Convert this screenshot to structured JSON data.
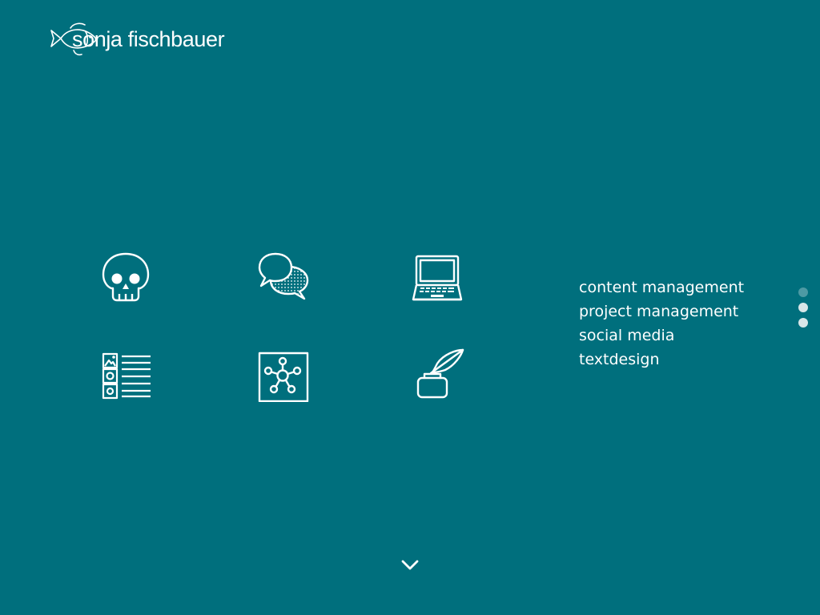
{
  "logo": {
    "text": "sonja fischbauer"
  },
  "icons": [
    {
      "name": "skull-icon"
    },
    {
      "name": "speech-bubbles-icon"
    },
    {
      "name": "laptop-icon"
    },
    {
      "name": "content-list-icon"
    },
    {
      "name": "network-icon"
    },
    {
      "name": "quill-inkwell-icon"
    }
  ],
  "services": [
    "content management",
    "project management",
    "social media",
    "textdesign"
  ],
  "pagination": {
    "count": 3,
    "active_index": 0
  },
  "scroll_down": {
    "icon": "chevron-down-icon"
  },
  "colors": {
    "background": "#006f7d",
    "foreground": "#ffffff",
    "dot_inactive": "#d8e6e8",
    "dot_active": "#4d9aa4"
  }
}
